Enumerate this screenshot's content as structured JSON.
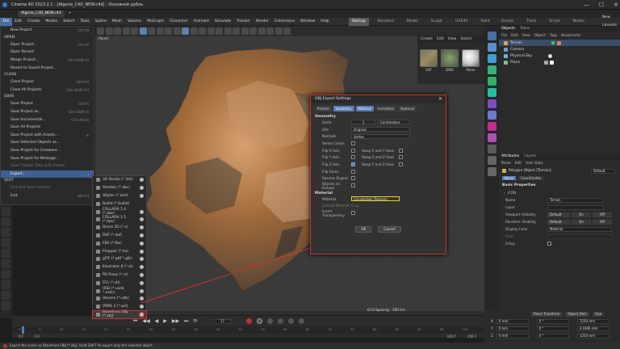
{
  "window": {
    "title": "Cinema 4D 2023.2.1 - [Algeria_C4D_NEW.c4d] - Основной дубль",
    "minimize": "—",
    "maximize": "☐",
    "close": "✕"
  },
  "file_tabs": [
    {
      "label": "Algeria_C4D_NEW.c4d"
    },
    {
      "label": "+"
    }
  ],
  "menubar": {
    "items": [
      "File",
      "Edit",
      "Create",
      "Modes",
      "Select",
      "Tools",
      "Spline",
      "Mesh",
      "Volume",
      "MoGraph",
      "Character",
      "Animate",
      "Simulate",
      "Tracker",
      "Render",
      "Extensions",
      "Window",
      "Help"
    ],
    "layouts": [
      "Startup",
      "Standard",
      "Model",
      "Sculpt",
      "UVEdit",
      "Paint",
      "Groom",
      "Track",
      "Script",
      "Nodes"
    ],
    "new_layouts": "New Layouts"
  },
  "file_menu": {
    "items": [
      {
        "label": "New Project",
        "shortcut": "Ctrl+N"
      },
      {
        "section": "OPEN"
      },
      {
        "label": "Open Project...",
        "shortcut": "Ctrl+O"
      },
      {
        "label": "Open Recent",
        "shortcut": "›"
      },
      {
        "label": "Merge Project...",
        "shortcut": "Ctrl+Shift+O"
      },
      {
        "label": "Revert to Saved Project...",
        "shortcut": ""
      },
      {
        "section": "CLOSE"
      },
      {
        "label": "Close Project",
        "shortcut": "Ctrl+F4"
      },
      {
        "label": "Close All Projects",
        "shortcut": "Ctrl+Shift+F4"
      },
      {
        "section": "SAVE"
      },
      {
        "label": "Save Project",
        "shortcut": "Ctrl+S"
      },
      {
        "label": "Save Project as...",
        "shortcut": "Ctrl+Shift+S"
      },
      {
        "label": "Save Incremental...",
        "shortcut": "Ctrl+Alt+S"
      },
      {
        "label": "Save All Projects",
        "shortcut": ""
      },
      {
        "label": "Save Project with Assets...",
        "shortcut": "⚙"
      },
      {
        "label": "Save Selected Objects as...",
        "shortcut": ""
      },
      {
        "label": "Save Project for Cineware...",
        "shortcut": ""
      },
      {
        "label": "Save Project for Melange...",
        "shortcut": ""
      },
      {
        "label": "Save Tracker Take with Assets",
        "shortcut": "",
        "dim": true
      },
      {
        "label": "Export...",
        "shortcut": "›",
        "highlight": true
      },
      {
        "section": "QUIT"
      },
      {
        "label": "Exit and Save License",
        "shortcut": "",
        "dim": true
      },
      {
        "label": "Exit",
        "shortcut": "Alt+F4"
      }
    ]
  },
  "export_menu": {
    "items": [
      {
        "label": "3D Studio (*.3ds)"
      },
      {
        "label": "Alembic (*.abc)"
      },
      {
        "label": "Allplan (*.xml)"
      },
      {
        "label": "Bullet (*.bullet)"
      },
      {
        "label": "COLLADA 1.4 (*.dae)"
      },
      {
        "label": "COLLADA 1.5 (*.dae)"
      },
      {
        "label": "Direct 3D (*.x)"
      },
      {
        "label": "DXF (*.dxf)"
      },
      {
        "label": "FBX (*.fbx)"
      },
      {
        "label": "Fhopper (*.ho)"
      },
      {
        "label": "glTF (*.gltf *.glb)"
      },
      {
        "label": "Illustrator 8 (*.ai)"
      },
      {
        "label": "RS Proxy (*.rs)"
      },
      {
        "label": "STL (*.stl)"
      },
      {
        "label": "USD (*.usda *.usdc)"
      },
      {
        "label": "Volume (*.vdb)"
      },
      {
        "label": "VRML 2 (*.wrl)"
      },
      {
        "label": "Wavefront OBJ (*.obj)",
        "selected": true
      }
    ]
  },
  "viewport": {
    "label": "Panel",
    "grid_spacing": "Grid Spacing : 100 km",
    "view_tabs": [
      "View",
      "Cameras",
      "Display",
      "Options",
      "Filter",
      "Panel"
    ]
  },
  "material_panel": {
    "menu": [
      "Create",
      "Edit",
      "View",
      "Select"
    ],
    "materials": [
      "SAT",
      "DMU",
      "Plane"
    ]
  },
  "dialog": {
    "title": "OBJ Export Settings",
    "close": "✕",
    "tabs": [
      "Presets",
      "Geometry",
      "Material",
      "Animation",
      "Optional"
    ],
    "active_tabs": [
      "Geometry",
      "Material"
    ],
    "geometry_header": "Geometry",
    "scale_label": "Scale",
    "scale_value": "1",
    "scale_unit": "Centimeters",
    "uvs_label": "UVs",
    "uvs_value": "Original",
    "normals_label": "Normals",
    "normals_value": "Vertex",
    "vertex_colors_label": "Vertex Colors",
    "flips": [
      {
        "label": "Flip X Axis",
        "checked": false,
        "swap_label": "Swap X and Y Axes",
        "swap_checked": false
      },
      {
        "label": "Flip Y Axis",
        "checked": false,
        "swap_label": "Swap X and Z Axes",
        "swap_checked": false
      },
      {
        "label": "Flip Z Axis",
        "checked": true,
        "swap_label": "Swap Y and Z Axes",
        "swap_checked": false
      }
    ],
    "flip_faces_label": "Flip Faces",
    "ngons_label": "Resolve N-gons",
    "groups_label": "Objects as Groups",
    "material_header": "Material",
    "material_label": "Material",
    "material_value": "Consolidate Textures",
    "default_material_label": "Default Material",
    "default_material_value": "Gray",
    "invert_transparency_label": "Invert Transparency",
    "ok": "OK",
    "cancel": "Cancel"
  },
  "objects_panel": {
    "tabs": [
      "Objects",
      "Takes"
    ],
    "menu": [
      "File",
      "Edit",
      "View",
      "Object",
      "Tags",
      "Bookmarks"
    ],
    "items": [
      {
        "label": "Terrain",
        "color": "#c8b04a",
        "selected": true
      },
      {
        "label": "Camera",
        "color": "#6aa0d8"
      },
      {
        "label": "Physical Sky",
        "color": "#74b0e0"
      },
      {
        "label": "Plane",
        "color": "#7fbf7f"
      }
    ]
  },
  "attributes_panel": {
    "tabs": [
      "Attributes",
      "Layers"
    ],
    "menu": [
      "Mode",
      "Edit",
      "User Data"
    ],
    "object_label": "Polygon Object [Terrain]",
    "mode_value": "Default",
    "subtabs": [
      "Basic",
      "Coordinates"
    ],
    "section_title": "Basic Properties",
    "icon_label": "ICON",
    "rows": [
      {
        "label": "Name",
        "value": "Terrain"
      },
      {
        "label": "Layer",
        "value": ""
      },
      {
        "label": "Viewport Visibility",
        "value": "Default",
        "on": "On",
        "off": "Off"
      },
      {
        "label": "Renderer Visibility",
        "value": "Default",
        "on": "On",
        "off": "Off"
      },
      {
        "label": "Display Color",
        "value": "Material"
      },
      {
        "label": "Color",
        "value": ""
      },
      {
        "label": "X-Ray",
        "value": ""
      }
    ]
  },
  "coords_panel": {
    "header": [
      "Reset Transform",
      "Object (Rel)",
      "Size"
    ],
    "rows": [
      {
        "axis": "X",
        "pos": "0 mm",
        "rot": "0 °",
        "size": "1250 mm"
      },
      {
        "axis": "Y",
        "pos": "0 mm",
        "rot": "0 °",
        "size": "3.1666 mm"
      },
      {
        "axis": "Z",
        "pos": "0 mm",
        "rot": "0 °",
        "size": "1250 mm"
      }
    ]
  },
  "timeline": {
    "start": "0 F",
    "current": "0 F",
    "frame_field": "17",
    "end": "100 F",
    "end2": "100 F",
    "ticks": [
      "0",
      "5",
      "10",
      "15",
      "20",
      "25",
      "30",
      "35",
      "40",
      "45",
      "50",
      "55",
      "60",
      "65",
      "70",
      "75",
      "80",
      "85",
      "90",
      "95",
      "100"
    ]
  },
  "status": "Export the scene as Wavefront OBJ (*.obj). Hold SHIFT to export only the selected object.",
  "colors": {
    "accent": "#5a7db5",
    "highlight_red": "#d03030",
    "menu_highlight": "#3d5f92",
    "selection_yellow": "#e8d030"
  }
}
